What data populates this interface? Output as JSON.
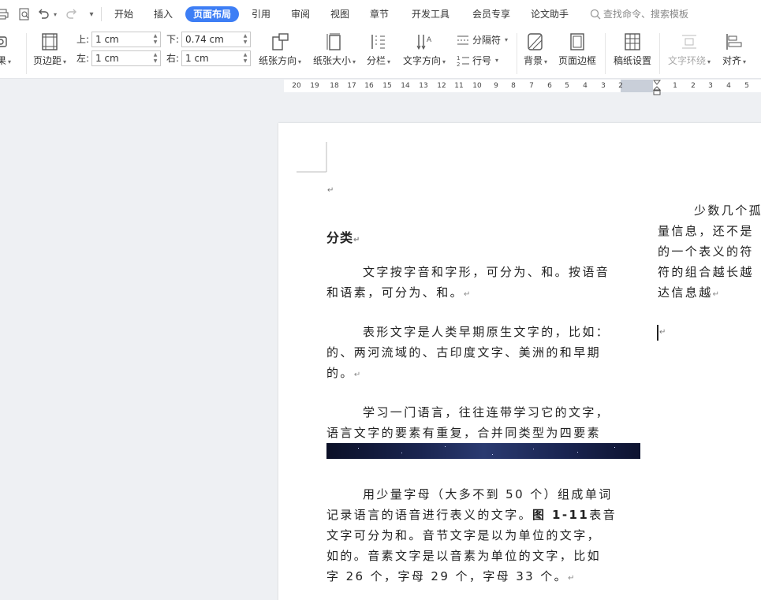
{
  "menu": {
    "items": [
      "开始",
      "插入",
      "页面布局",
      "引用",
      "审阅",
      "视图",
      "章节",
      "开发工具",
      "会员专享",
      "论文助手"
    ],
    "active": "页面布局",
    "search_placeholder": "查找命令、搜索模板"
  },
  "toolbar": {
    "effects_partial_label": "果",
    "margin_button_label": "页边距",
    "margins": {
      "top_label": "上:",
      "top_value": "1 cm",
      "bottom_label": "下:",
      "bottom_value": "0.74 cm",
      "left_label": "左:",
      "left_value": "1 cm",
      "right_label": "右:",
      "right_value": "1 cm"
    },
    "orientation_label": "纸张方向",
    "size_label": "纸张大小",
    "columns_label": "分栏",
    "text_direction_label": "文字方向",
    "break_label": "分隔符",
    "line_number_label": "行号",
    "background_label": "背景",
    "page_border_label": "页面边框",
    "manuscript_label": "稿纸设置",
    "text_wrap_label": "文字环绕",
    "align_label": "对齐"
  },
  "ruler": {
    "left_ticks": [
      "20",
      "19",
      "18",
      "17",
      "16",
      "15",
      "14",
      "13",
      "12",
      "11",
      "10",
      "9",
      "8",
      "7",
      "6",
      "5",
      "4",
      "3",
      "2"
    ],
    "right_ticks": [
      "1",
      "2",
      "3",
      "4",
      "5"
    ]
  },
  "document": {
    "heading": "分类",
    "left_paragraphs": [
      [
        "文字按字音和字形，可分为、和。按语音",
        "和语素，可分为、和。"
      ],
      [
        "表形文字是人类早期原生文字的，比如：",
        "的、两河流域的、古印度文字、美洲的和早期",
        "的。"
      ],
      [
        "学习一门语言，往往连带学习它的文字，",
        "语言文字的要素有重复，合并同类型为四要素"
      ],
      [
        "用少量字母（大多不到 50 个）组成单词",
        "记录语言的语音进行表义的文字。",
        "文字可分为和。音节文字是以为单位的文字，",
        "如的。音素文字是以音素为单位的文字，比如",
        "字 26 个，字母 29 个，字母 33 个。"
      ]
    ],
    "figure_ref": "图 1-11",
    "figure_ref_suffix": "表音",
    "right_paragraph": [
      "少数几个孤",
      "量信息，还不是",
      "的一个表义的符",
      "符的组合越长越",
      "达信息越"
    ]
  }
}
